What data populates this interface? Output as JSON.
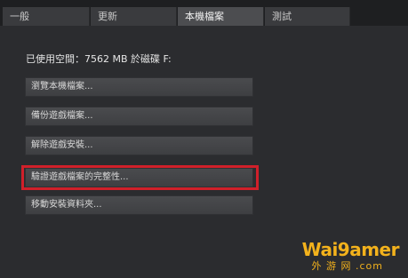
{
  "tabs": [
    {
      "label": "一般"
    },
    {
      "label": "更新"
    },
    {
      "label": "本機檔案"
    },
    {
      "label": "測試"
    }
  ],
  "disk_info": "已使用空間：7562 MB 於磁碟 F:",
  "buttons": {
    "browse": "瀏覽本機檔案...",
    "backup": "備份遊戲檔案...",
    "uninstall": "解除遊戲安裝...",
    "verify": "驗證遊戲檔案的完整性...",
    "move": "移動安裝資料夾..."
  },
  "watermark": {
    "main": "Wai9amer",
    "sub": "外 游 网 .com"
  },
  "colors": {
    "highlight": "#d0202a",
    "watermark": "#f3b21c"
  }
}
